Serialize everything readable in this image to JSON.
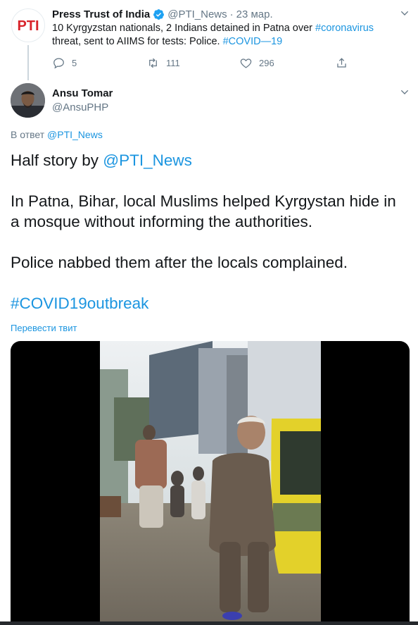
{
  "parent_tweet": {
    "name": "Press Trust of India",
    "handle": "@PTI_News",
    "separator": "·",
    "date": "23 мар.",
    "text_1": "10 Kyrgyzstan nationals, 2 Indians detained in Patna over ",
    "hashtag_1": "#coronavirus",
    "text_2": " threat, sent to AIIMS for tests: Police. ",
    "hashtag_2": "#COVID—19",
    "reply_count": "5",
    "retweet_count": "111",
    "like_count": "296",
    "avatar_logo_text": "PTI"
  },
  "reply_tweet": {
    "name": "Ansu Tomar",
    "handle": "@AnsuPHP",
    "reply_prefix": "В ответ ",
    "reply_handle": "@PTI_News",
    "line1_text": "Half story by ",
    "line1_mention": "@PTI_News",
    "paragraph_2": "In Patna, Bihar, local Muslims helped  Kyrgystan hide in a mosque without informing the authorities.",
    "paragraph_3": "Police nabbed them after the locals complained.",
    "hashtag": "#COVID19outbreak",
    "translate_label": "Перевести твит"
  },
  "colors": {
    "link": "#1b95e0",
    "secondary_text": "#657786",
    "verified": "#1da1f2",
    "pti_red": "#d8232a"
  }
}
